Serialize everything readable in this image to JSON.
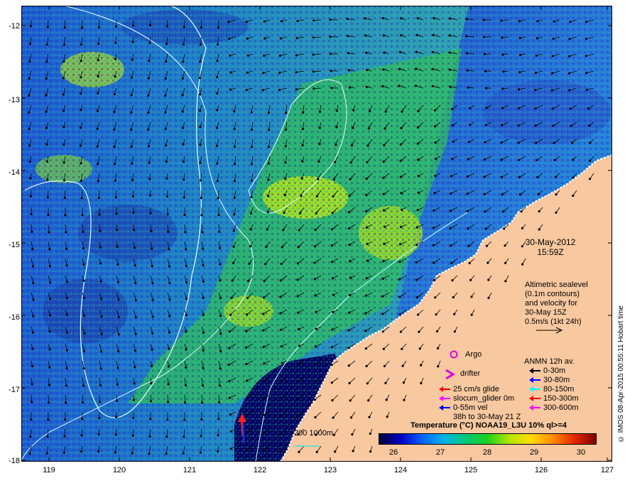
{
  "map": {
    "lon_range": [
      118.6,
      127.0
    ],
    "lat_range": [
      -18.0,
      -11.8
    ],
    "x_ticks": [
      "119",
      "120",
      "121",
      "122",
      "123",
      "124",
      "125",
      "126",
      "127"
    ],
    "y_ticks": [
      "-12",
      "-13",
      "-14",
      "-15",
      "-16",
      "-17",
      "-18"
    ],
    "land_color": "#f8c8a0",
    "deep_sea_color": "#00005a"
  },
  "timestamp": {
    "date": "30-May-2012",
    "time": "15:59Z"
  },
  "altimetry_note": {
    "line1": "Altimetric sealevel",
    "line2": "(0.1m contours)",
    "line3": "and velocity for",
    "line4": "30-May 15Z",
    "line5": "0.5m/s (1kt 24h)"
  },
  "legend_left": {
    "argo": "Argo",
    "drifter": "drifter",
    "glide": "25 cm/s glide",
    "slocum": "slocum_glider 0m",
    "vel": "0-55m vel",
    "vel_time": "38h to 30-May 21 Z",
    "colors": {
      "argo": "#e000e0",
      "glide": "#ff0000",
      "slocum": "#ff00ff",
      "vel": "#0000ff"
    }
  },
  "legend_right": {
    "title": "ANMN 12h av.",
    "rows": [
      {
        "label": "0-30m",
        "color": "#000000"
      },
      {
        "label": "30-80m",
        "color": "#0000ff"
      },
      {
        "label": "80-150m",
        "color": "#00ffff"
      },
      {
        "label": "150-300m",
        "color": "#ff0000"
      },
      {
        "label": "300-600m",
        "color": "#ff00ff"
      }
    ]
  },
  "contour_label": "200  1000m",
  "colorbar": {
    "title": "Temperature (°C) NOAA19_L3U 10% ql>=4",
    "ticks": [
      "26",
      "27",
      "28",
      "29",
      "30"
    ],
    "range": [
      25.4,
      30.6
    ]
  },
  "credit": "© IMOS 08-Apr-2015 00:55:11 Hobart time"
}
